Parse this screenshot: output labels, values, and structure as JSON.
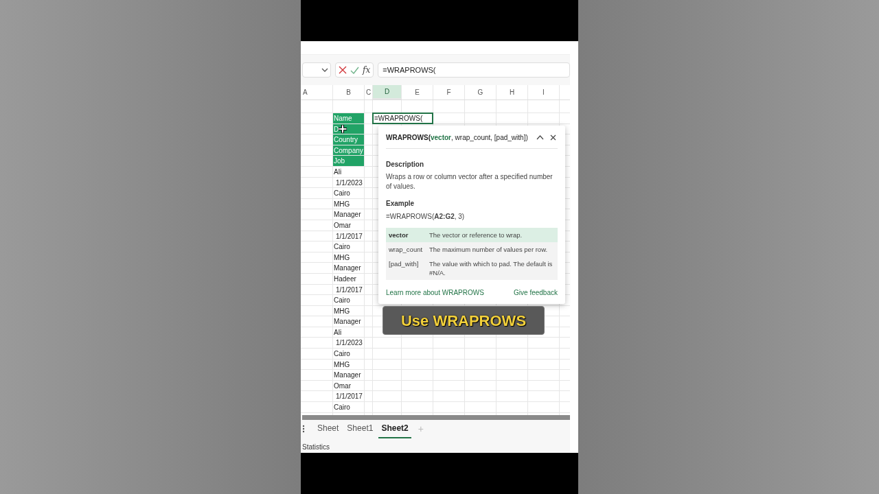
{
  "formula_bar": {
    "function_button": "fx",
    "value": "=WRAPROWS("
  },
  "columns": [
    {
      "label": "A",
      "selected": false
    },
    {
      "label": "B",
      "selected": false
    },
    {
      "label": "C",
      "selected": false
    },
    {
      "label": "D",
      "selected": true
    },
    {
      "label": "E",
      "selected": false
    },
    {
      "label": "F",
      "selected": false
    },
    {
      "label": "G",
      "selected": false
    },
    {
      "label": "H",
      "selected": false
    },
    {
      "label": "I",
      "selected": false
    }
  ],
  "active_cell": {
    "value": "=WRAPROWS("
  },
  "column_b": [
    {
      "text": "Name",
      "kind": "header"
    },
    {
      "text": "D",
      "kind": "header"
    },
    {
      "text": "Country",
      "kind": "header"
    },
    {
      "text": "Company",
      "kind": "header"
    },
    {
      "text": "Job",
      "kind": "header"
    },
    {
      "text": "Ali",
      "kind": "text"
    },
    {
      "text": "1/1/2023",
      "kind": "date"
    },
    {
      "text": "Cairo",
      "kind": "text"
    },
    {
      "text": "MHG",
      "kind": "text"
    },
    {
      "text": "Manager",
      "kind": "text"
    },
    {
      "text": "Omar",
      "kind": "text"
    },
    {
      "text": "1/1/2017",
      "kind": "date"
    },
    {
      "text": "Cairo",
      "kind": "text"
    },
    {
      "text": "MHG",
      "kind": "text"
    },
    {
      "text": "Manager",
      "kind": "text"
    },
    {
      "text": "Hadeer",
      "kind": "text"
    },
    {
      "text": "1/1/2017",
      "kind": "date"
    },
    {
      "text": "Cairo",
      "kind": "text"
    },
    {
      "text": "MHG",
      "kind": "text"
    },
    {
      "text": "Manager",
      "kind": "text"
    },
    {
      "text": "Ali",
      "kind": "text"
    },
    {
      "text": "1/1/2023",
      "kind": "date"
    },
    {
      "text": "Cairo",
      "kind": "text"
    },
    {
      "text": "MHG",
      "kind": "text"
    },
    {
      "text": "Manager",
      "kind": "text"
    },
    {
      "text": "Omar",
      "kind": "text"
    },
    {
      "text": "1/1/2017",
      "kind": "date"
    },
    {
      "text": "Cairo",
      "kind": "text"
    }
  ],
  "tooltip": {
    "function": "WRAPROWS(",
    "args": [
      {
        "text": "vector",
        "selected": true
      },
      {
        "text": "wrap_count",
        "selected": false
      },
      {
        "text": "[pad_with]",
        "selected": false
      }
    ],
    "separator": ", ",
    "close_paren": ")",
    "description_heading": "Description",
    "description": "Wraps a row or column vector after a specified number of values.",
    "example_heading": "Example",
    "example": "=WRAPROWS(**A2:G2**, 3)",
    "arguments": [
      {
        "name": "vector",
        "text": "The vector or reference to wrap.",
        "selected": true
      },
      {
        "name": "wrap_count",
        "text": "The maximum number of values per row.",
        "selected": false
      },
      {
        "name": "[pad_with]",
        "text": "The value with which to pad. The default is #N/A.",
        "selected": false
      }
    ],
    "learn_more": "Learn more about WRAPROWS",
    "feedback": "Give feedback"
  },
  "caption": "Use WRAPROWS",
  "sheet_tabs": [
    {
      "label": "Sheet",
      "selected": false
    },
    {
      "label": "Sheet1",
      "selected": false
    },
    {
      "label": "Sheet2",
      "selected": true
    }
  ],
  "add_sheet": "+",
  "status_bar": "Statistics"
}
